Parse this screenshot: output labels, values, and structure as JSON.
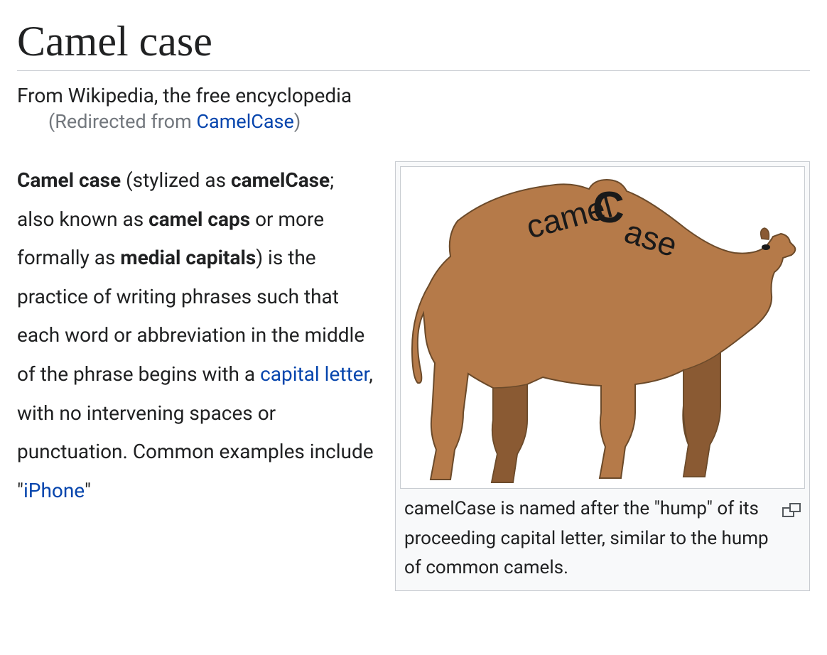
{
  "title": "Camel case",
  "subtitle": "From Wikipedia, the free encyclopedia",
  "redirect": {
    "prefix": "(Redirected from ",
    "link": "CamelCase",
    "suffix": ")"
  },
  "paragraph": {
    "b1": "Camel case",
    "t1": " (stylized as ",
    "b2": "camelCase",
    "t2": "; also known as ",
    "b3": "camel caps",
    "t3": " or more formally as ",
    "b4": "medial capitals",
    "t4": ") is the practice of writing phrases such that each word or abbreviation in the middle of the phrase begins with a ",
    "link1": "capital letter",
    "t5": ", with no intervening spaces or punctuation. Common examples include \"",
    "link2": "iPhone",
    "t6": "\""
  },
  "image": {
    "label_camel": "camel",
    "label_C": "C",
    "label_ase": "ase"
  },
  "caption": "camelCase is named after the \"hump\" of its proceeding capital letter, similar to the hump of common camels."
}
